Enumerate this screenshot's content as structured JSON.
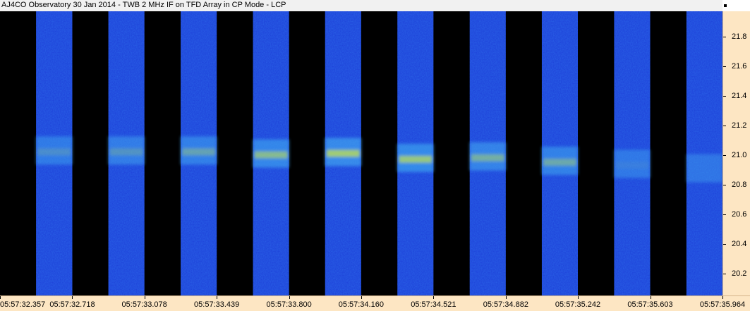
{
  "chart_data": {
    "type": "heatmap",
    "title": "AJ4CO Observatory 30 Jan 2014 - TWB 2 MHz IF on TFD Array in CP Mode - LCP",
    "xlabel": "",
    "ylabel": "",
    "y_ticks": [
      "20.2",
      "20.4",
      "20.6",
      "20.8",
      "21.0",
      "21.2",
      "21.4",
      "21.6",
      "21.8"
    ],
    "ylim": [
      20.05,
      21.97
    ],
    "x_ticks": [
      "05:57:32.357",
      "05:57:32.718",
      "05:57:33.078",
      "05:57:33.439",
      "05:57:33.800",
      "05:57:34.160",
      "05:57:34.521",
      "05:57:34.882",
      "05:57:35.242",
      "05:57:35.603",
      "05:57:35.964"
    ],
    "xlim_seconds": [
      32.357,
      35.964
    ],
    "colors": {
      "background": "#1d3fd8",
      "gap": "#000000",
      "emission_weak": "#3fa6f0",
      "emission_strong": "#d8f036",
      "axis_panel": "#fde6c3"
    },
    "data_windows_seconds": [
      [
        32.537,
        32.718
      ],
      [
        32.898,
        33.078
      ],
      [
        33.259,
        33.439
      ],
      [
        33.62,
        33.8
      ],
      [
        33.98,
        34.16
      ],
      [
        34.341,
        34.521
      ],
      [
        34.702,
        34.882
      ],
      [
        35.062,
        35.242
      ],
      [
        35.423,
        35.603
      ],
      [
        35.784,
        35.964
      ]
    ],
    "emission_band_mhz": {
      "center": [
        21.02,
        21.02,
        21.02,
        21.0,
        21.01,
        20.97,
        20.98,
        20.95,
        20.93,
        20.9
      ],
      "intensity": [
        0.45,
        0.5,
        0.6,
        0.8,
        0.95,
        0.9,
        0.7,
        0.65,
        0.35,
        0.25
      ]
    }
  }
}
